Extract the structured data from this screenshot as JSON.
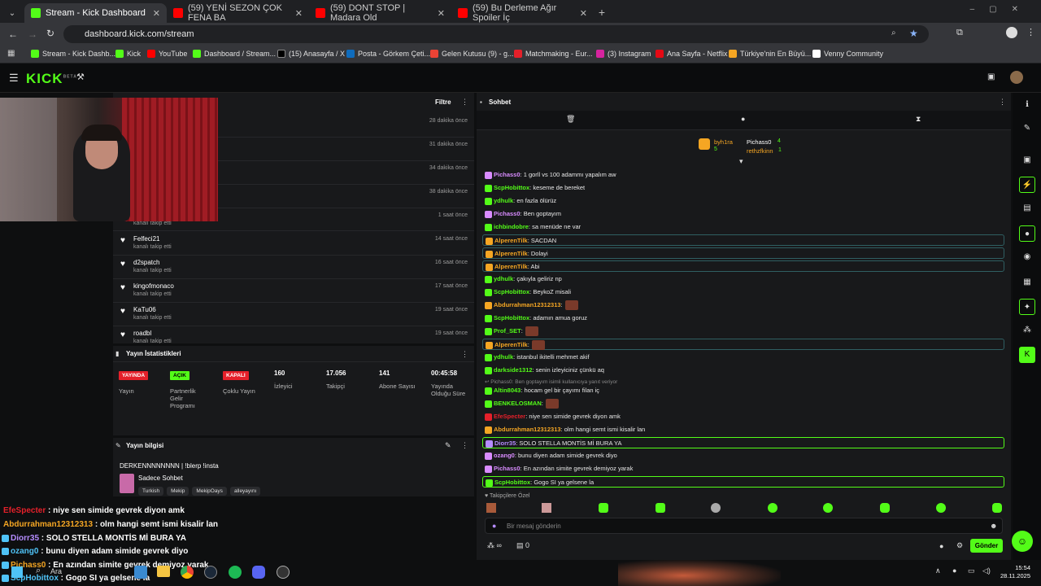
{
  "browser": {
    "tabs": [
      {
        "title": "Stream - Kick Dashboard",
        "color": "#53fc18"
      },
      {
        "title": "(59) YENİ SEZON ÇOK FENA BA",
        "color": "#ff0000"
      },
      {
        "title": "(59) DONT STOP | Madara Old",
        "color": "#ff0000"
      },
      {
        "title": "(59) Bu Derleme Ağır Spoiler İç",
        "color": "#ff0000"
      }
    ],
    "url": "dashboard.kick.com/stream",
    "bookmarks": [
      "Stream - Kick Dashb...",
      "Kick",
      "YouTube",
      "Dashboard / Stream...",
      "(15) Anasayfa / X",
      "Posta - Görkem Çeti...",
      "Gelen Kutusu (9) - g...",
      "Matchmaking - Eur...",
      "(3) Instagram",
      "Ana Sayfa - Netflix",
      "Türkiye'nin En Büyü...",
      "Venny Community"
    ]
  },
  "kick": {
    "logo": "KICK",
    "beta": "BETA",
    "activity": {
      "filter_label": "Filtre",
      "times_top": [
        "28 dakika önce",
        "31 dakika önce",
        "34 dakika önce",
        "38 dakika önce",
        "1 saat önce"
      ],
      "followed_text": "kanalı takip etti",
      "followers": [
        {
          "name": "Felfeci21",
          "time": "14 saat önce"
        },
        {
          "name": "d2spatch",
          "time": "16 saat önce"
        },
        {
          "name": "kingofmonaco",
          "time": "17 saat önce"
        },
        {
          "name": "KaTu06",
          "time": "19 saat önce"
        },
        {
          "name": "roadbl",
          "time": "19 saat önce"
        }
      ]
    },
    "stats": {
      "title": "Yayın İstatistikleri",
      "items": [
        {
          "badge": "YAYINDA",
          "badge_color": "#e5202a",
          "label": "Yayın"
        },
        {
          "badge": "AÇIK",
          "badge_color": "#53fc18",
          "label": "Partnerlik Gelir Programı"
        },
        {
          "badge": "KAPALI",
          "badge_color": "#e5202a",
          "label": "Çoklu Yayın"
        },
        {
          "value": "160",
          "label": "İzleyici"
        },
        {
          "value": "17.056",
          "label": "Takipçi"
        },
        {
          "value": "141",
          "label": "Abone Sayısı"
        },
        {
          "value": "00:45:58",
          "label": "Yayında Olduğu Süre"
        }
      ]
    },
    "info": {
      "title": "Yayın bilgisi",
      "stream_title": "DERKENNNNNNNN | !blerp !insta",
      "mode": "Sadece Sohbet",
      "tags": [
        "Turkish",
        "Mekip",
        "MekipOays",
        "alleyayını"
      ]
    },
    "chat": {
      "title": "Sohbet",
      "leaders": [
        {
          "name": "byh1ra",
          "count": "5"
        },
        {
          "name": "Pichass0",
          "count": "4"
        },
        {
          "name": "rethzfkinn",
          "count": "1"
        }
      ],
      "messages": [
        {
          "user": "Pichass0",
          "color": "#d98cff",
          "text": ": 1 gorll vs 100 adammı yapalım aw",
          "style": ""
        },
        {
          "user": "ScpHobittox",
          "color": "#53fc18",
          "text": ": keseme de bereket",
          "style": ""
        },
        {
          "user": "ydhulk",
          "color": "#53fc18",
          "text": ": en fazla ölürüz",
          "style": ""
        },
        {
          "user": "Pichass0",
          "color": "#d98cff",
          "text": ": Ben goptayım",
          "style": ""
        },
        {
          "user": "ichbindobre",
          "color": "#53fc18",
          "text": ": sa menüde ne var",
          "style": ""
        },
        {
          "user": "AlperenTilk",
          "color": "#f5a623",
          "text": ": SACDAN",
          "style": "hl"
        },
        {
          "user": "AlperenTilk",
          "color": "#f5a623",
          "text": ": Dolayi",
          "style": "hl"
        },
        {
          "user": "AlperenTilk",
          "color": "#f5a623",
          "text": ": Abi",
          "style": "hl"
        },
        {
          "user": "ydhulk",
          "color": "#53fc18",
          "text": ": çakıyla geliriz np",
          "style": ""
        },
        {
          "user": "ScpHobittox",
          "color": "#53fc18",
          "text": ": BeykoZ misali",
          "style": ""
        },
        {
          "user": "Abdurrahman12312313",
          "color": "#f5a623",
          "text": ":",
          "style": "emote"
        },
        {
          "user": "ScpHobittox",
          "color": "#53fc18",
          "text": ": adamın amua goruz",
          "style": ""
        },
        {
          "user": "Prof_SET",
          "color": "#53fc18",
          "text": ":",
          "style": "emote"
        },
        {
          "user": "AlperenTilk",
          "color": "#f5a623",
          "text": ":",
          "style": "hl-emote"
        },
        {
          "user": "ydhulk",
          "color": "#53fc18",
          "text": ": istanbul ikitelli mehmet akif",
          "style": ""
        },
        {
          "user": "darkside1312",
          "color": "#53fc18",
          "text": ": senin izleyiciniz çünkü aq",
          "style": ""
        },
        {
          "user": "Altin8043",
          "color": "#53fc18",
          "text": ": hocam gel bir çayımı filan iç",
          "style": "reply"
        },
        {
          "user": "BENKELOSMAN",
          "color": "#53fc18",
          "text": ":",
          "style": "emote"
        },
        {
          "user": "EfeSpecter",
          "color": "#e5202a",
          "text": ": niye sen simide gevrek diyon amk",
          "style": ""
        },
        {
          "user": "Abdurrahman12312313",
          "color": "#f5a623",
          "text": ": olm hangi semt ismi kisalir lan",
          "style": ""
        },
        {
          "user": "Diorr35",
          "color": "#b58cff",
          "text": ": SOLO STELLA MONTİS Mİ BURA YA",
          "style": "hl2"
        },
        {
          "user": "ozang0",
          "color": "#d98cff",
          "text": ": bunu diyen adam simide gevrek diyo",
          "style": ""
        },
        {
          "user": "Pichass0",
          "color": "#d98cff",
          "text": ": En azından simite gevrek demiyoz yarak",
          "style": ""
        },
        {
          "user": "ScpHobittox",
          "color": "#53fc18",
          "text": ": Gogo SI ya gelsene la",
          "style": "hl2"
        }
      ],
      "reply_note": "Pichass0: Ben goptayım isimli kullanıcıya yanıt veriyor",
      "subscriber_label": "Takipçilere Özel",
      "input_placeholder": "Bir mesaj gönderin",
      "counter": "0",
      "send_label": "Gönder"
    }
  },
  "overlay_chat": [
    {
      "user": "EfeSpecter",
      "color": "#e5202a",
      "text": " : niye sen simide gevrek diyon amk"
    },
    {
      "user": "Abdurrahman12312313",
      "color": "#f5a623",
      "text": " : olm hangi semt ismi kisalir lan"
    },
    {
      "user": "Diorr35",
      "color": "#b58cff",
      "text": " : SOLO STELLA MONTİS Mİ BURA YA"
    },
    {
      "user": "ozang0",
      "color": "#4fc3f7",
      "text": " : bunu diyen adam simide gevrek diyo"
    },
    {
      "user": "Pichass0",
      "color": "#f5a623",
      "text": " : En azından simite gevrek demiyoz yarak"
    },
    {
      "user": "ScpHobittox",
      "color": "#4fc3f7",
      "text": " : Gogo SI ya gelsene la"
    }
  ],
  "taskbar": {
    "search": "Ara",
    "time": "15:54",
    "date": "28.11.2025"
  }
}
